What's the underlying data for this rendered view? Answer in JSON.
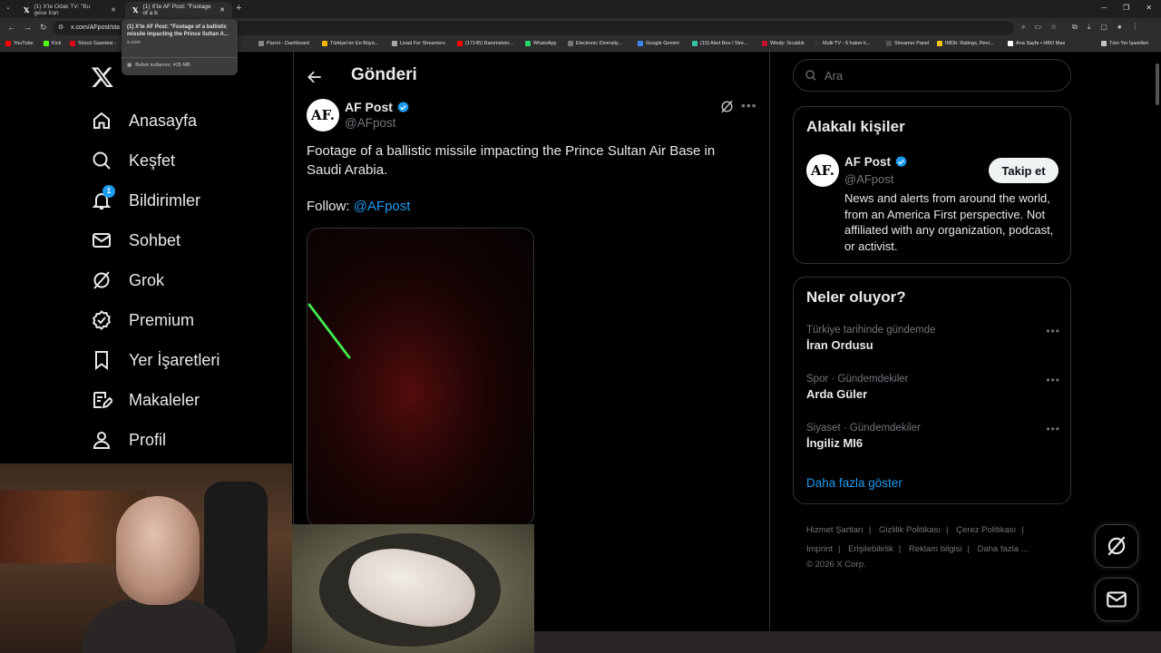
{
  "browser": {
    "tabs": [
      {
        "title": "(1) X'te Odak TV: \"Bu gece İran",
        "active": false
      },
      {
        "title": "(1) X'te AF Post: \"Footage of a b",
        "active": true
      }
    ],
    "url": "x.com/AFpost/sta",
    "tooltip": {
      "title": "(1) X'te AF Post: \"Footage of a ballistic missile impacting the Prince Sultan A...",
      "domain": "x.com",
      "memory": "Bellek kullanımı: 435 MB"
    },
    "bookmarks": [
      {
        "label": "YouTube",
        "color": "#ff0000"
      },
      {
        "label": "Kick",
        "color": "#53fc18"
      },
      {
        "label": "Sözcü Gazetesi -",
        "color": "#e30613"
      },
      {
        "label": "Parrot - Dashboard",
        "color": "#888888"
      },
      {
        "label": "Türkiye'nin En Büyü...",
        "color": "#f4b400"
      },
      {
        "label": "Livad For Streamers",
        "color": "#aaaaaa"
      },
      {
        "label": "(17145) Rammstein...",
        "color": "#ff0000"
      },
      {
        "label": "WhatsApp",
        "color": "#25d366"
      },
      {
        "label": "Electronic Diversity...",
        "color": "#777777"
      },
      {
        "label": "Google Gemini",
        "color": "#4285f4"
      },
      {
        "label": "(19) Alert Box / Stre...",
        "color": "#31c3a2"
      },
      {
        "label": "Windy: Sıcaklık",
        "color": "#c8102e"
      },
      {
        "label": "Multi TV - 6 haber k...",
        "color": "#333333"
      },
      {
        "label": "Streamer Panel",
        "color": "#555555"
      },
      {
        "label": "IMDb: Ratings, Revi...",
        "color": "#f5c518"
      },
      {
        "label": "Ana Sayfa • HBO Max",
        "color": "#ffffff"
      },
      {
        "label": "Tüm Yer İşaretleri",
        "color": "#c4c7c5"
      }
    ]
  },
  "nav": {
    "items": [
      {
        "label": "Anasayfa",
        "icon": "home-icon"
      },
      {
        "label": "Keşfet",
        "icon": "search-icon"
      },
      {
        "label": "Bildirimler",
        "icon": "bell-icon",
        "badge": "1"
      },
      {
        "label": "Sohbet",
        "icon": "mail-icon"
      },
      {
        "label": "Grok",
        "icon": "grok-icon"
      },
      {
        "label": "Premium",
        "icon": "premium-icon"
      },
      {
        "label": "Yer İşaretleri",
        "icon": "bookmark-icon"
      },
      {
        "label": "Makaleler",
        "icon": "articles-icon"
      },
      {
        "label": "Profil",
        "icon": "profile-icon"
      }
    ]
  },
  "main": {
    "title": "Gönderi",
    "post": {
      "avatar_text": "AF.",
      "name": "AF Post",
      "handle": "@AFpost",
      "text": "Footage of a ballistic missile impacting the Prince Sultan Air Base in Saudi Arabia.",
      "follow_prefix": "Follow: ",
      "follow_link": "@AFpost"
    }
  },
  "sidebar": {
    "search_placeholder": "Ara",
    "related": {
      "title": "Alakalı kişiler",
      "avatar_text": "AF.",
      "name": "AF Post",
      "handle": "@AFpost",
      "follow_label": "Takip et",
      "bio": "News and alerts from around the world, from an America First perspective. Not affiliated with any organization, podcast, or activist."
    },
    "trends": {
      "title": "Neler oluyor?",
      "items": [
        {
          "category": "Türkiye tarihinde gündemde",
          "name": "İran Ordusu"
        },
        {
          "category": "Spor · Gündemdekiler",
          "name": "Arda Güler"
        },
        {
          "category": "Siyaset · Gündemdekiler",
          "name": "İngiliz MI6"
        }
      ],
      "show_more": "Daha fazla göster"
    },
    "footer": {
      "links": [
        "Hizmet Şartları",
        "Gizlilik Politikası",
        "Çerez Politikası",
        "Imprint",
        "Erişilebilirlik",
        "Reklam bilgisi",
        "Daha fazla ..."
      ],
      "copyright": "© 2026 X Corp."
    }
  },
  "colors": {
    "accent": "#1d9bf0",
    "background": "#000000",
    "text": "#e7e9ea",
    "muted": "#71767b",
    "border": "#2f3336"
  }
}
